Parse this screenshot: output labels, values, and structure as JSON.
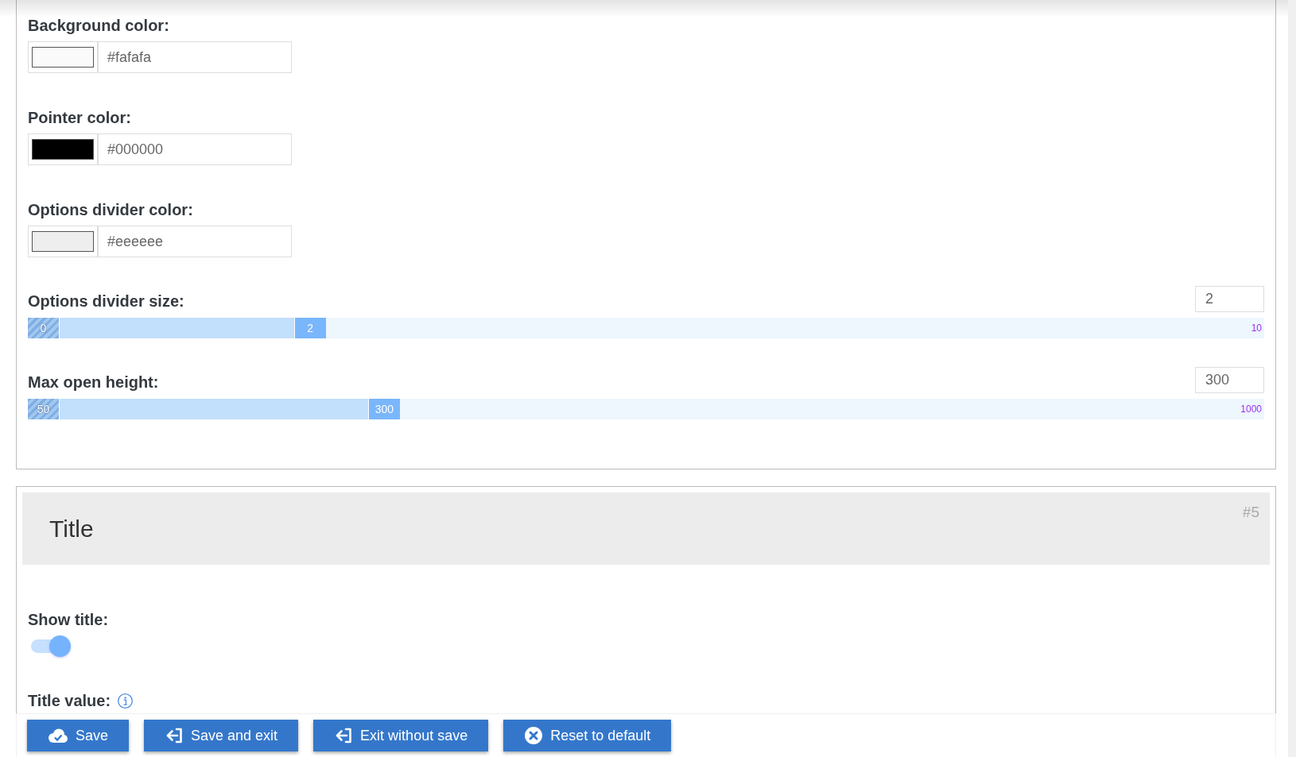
{
  "settings_panel": {
    "color_fields": [
      {
        "label": "Background color:",
        "color": "#fafafa",
        "value": "#fafafa"
      },
      {
        "label": "Pointer color:",
        "color": "#000000",
        "value": "#000000"
      },
      {
        "label": "Options divider color:",
        "color": "#eeeeee",
        "value": "#eeeeee"
      }
    ],
    "sliders": [
      {
        "label": "Options divider size:",
        "field_value": "2",
        "min_label": "0",
        "thumb_label": "2",
        "max_label": "10",
        "level": 0.228
      },
      {
        "label": "Max open height:",
        "field_value": "300",
        "min_label": "50",
        "thumb_label": "300",
        "max_label": "1000",
        "level": 0.288
      }
    ]
  },
  "title_panel": {
    "heading": "Title",
    "number": "#5",
    "fields": [
      {
        "kind": "toggle",
        "label": "Show title:",
        "on": true
      },
      {
        "kind": "text",
        "label": "Title value:",
        "info": true
      }
    ]
  },
  "action_bar": {
    "buttons": [
      {
        "kind": "save",
        "label": "Save"
      },
      {
        "kind": "saveexit",
        "label": "Save and exit"
      },
      {
        "kind": "exit",
        "label": "Exit without save"
      },
      {
        "kind": "reset",
        "label": "Reset to default"
      }
    ]
  }
}
